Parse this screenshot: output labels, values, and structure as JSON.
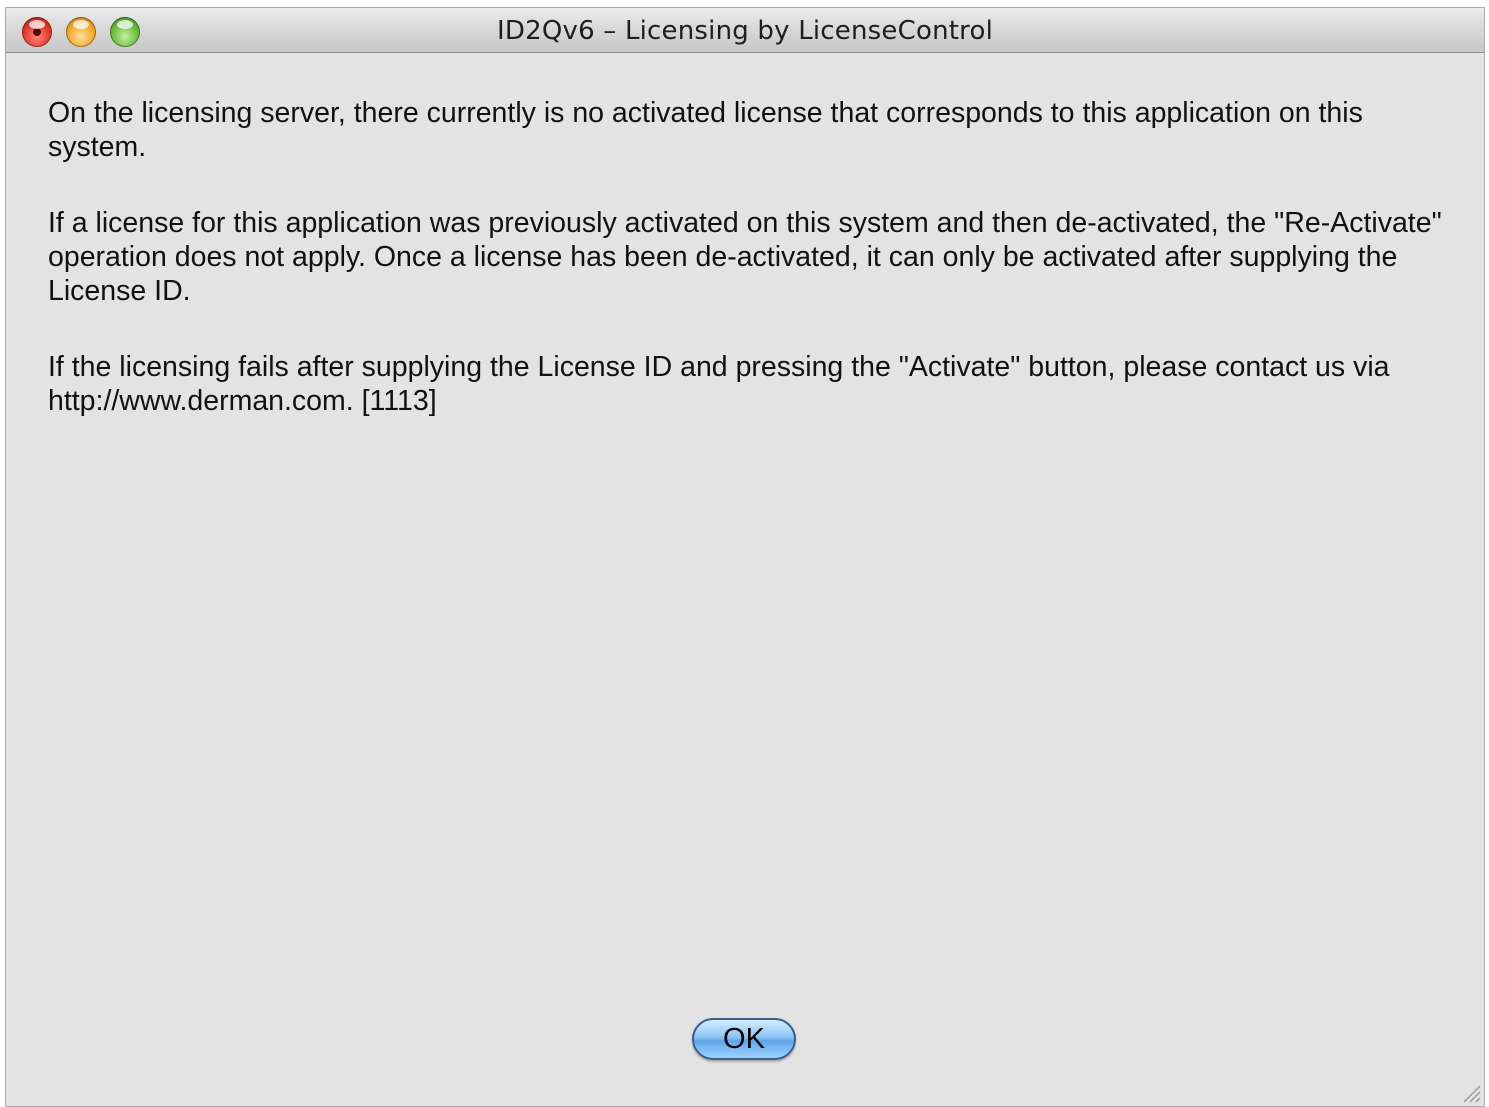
{
  "window": {
    "title": "ID2Qv6 –  Licensing by LicenseControl"
  },
  "message": {
    "paragraphs": [
      "On the licensing server, there currently is no activated license that corresponds to this application on this system.",
      "If a license for this application was previously activated on this system and then de-activated, the \"Re-Activate\" operation does not apply. Once a license has been de-activated, it can only be activated after supplying the License ID.",
      "If the licensing fails after supplying the License ID and pressing the \"Activate\" button, please contact us via http://www.derman.com. [1113]"
    ]
  },
  "buttons": {
    "ok_label": "OK"
  },
  "icons": {
    "close": "close-icon",
    "minimize": "minimize-icon",
    "zoom": "zoom-icon",
    "resize": "resize-grip-icon"
  },
  "colors": {
    "window_background": "#e3e3e3",
    "button_accent": "#5fa5ea"
  }
}
